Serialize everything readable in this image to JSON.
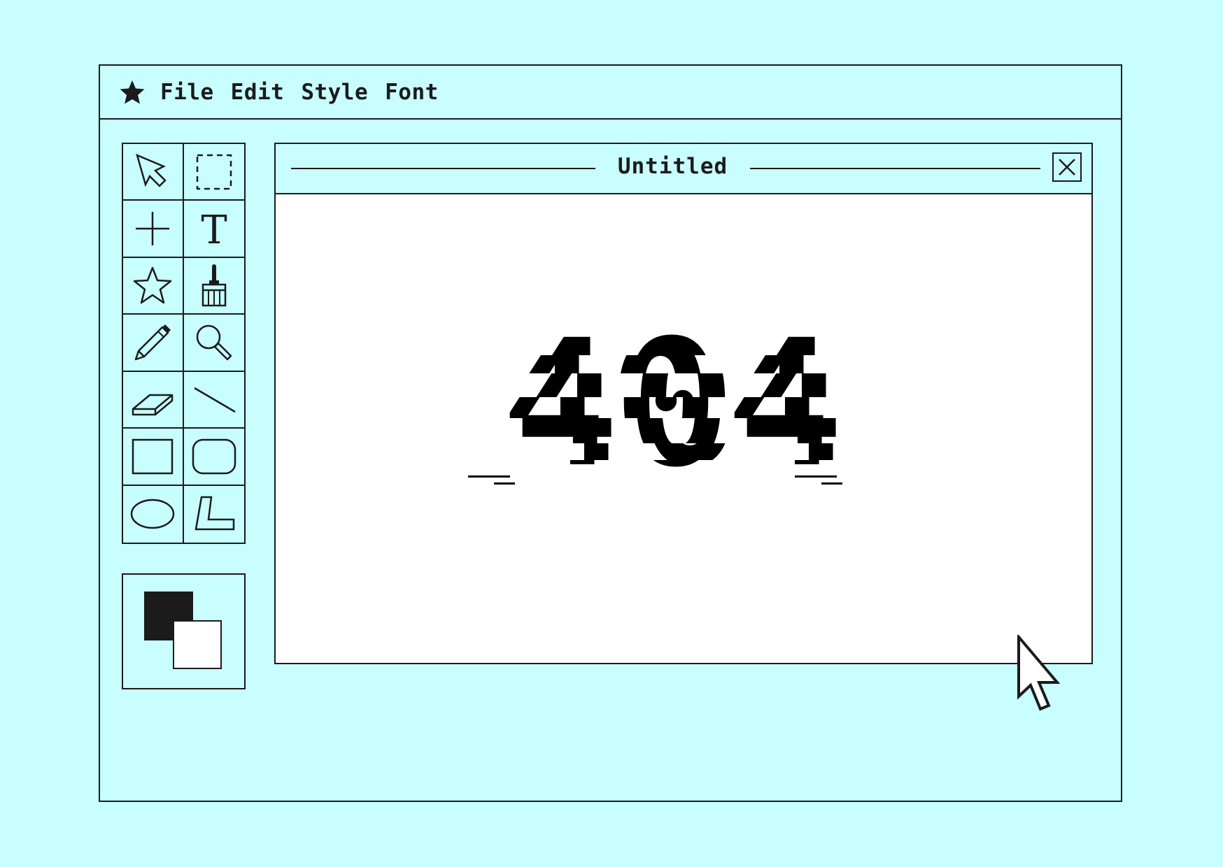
{
  "menubar": {
    "logo_icon": "star-icon",
    "items": [
      "File",
      "Edit",
      "Style",
      "Font"
    ]
  },
  "document": {
    "title": "Untitled",
    "canvas_text": "404"
  },
  "tools": [
    {
      "name": "arrow-select-icon"
    },
    {
      "name": "marquee-select-icon"
    },
    {
      "name": "crosshair-icon"
    },
    {
      "name": "text-tool-icon",
      "glyph": "T"
    },
    {
      "name": "star-shape-icon"
    },
    {
      "name": "paint-brush-icon"
    },
    {
      "name": "pencil-icon"
    },
    {
      "name": "magnifier-icon"
    },
    {
      "name": "eraser-icon"
    },
    {
      "name": "line-tool-icon"
    },
    {
      "name": "rectangle-tool-icon"
    },
    {
      "name": "rounded-rectangle-tool-icon"
    },
    {
      "name": "ellipse-tool-icon"
    },
    {
      "name": "polygon-tool-icon"
    }
  ],
  "colors": {
    "background": "#c8fefd",
    "ink": "#1b1b1b",
    "foreground_swatch": "#1b1b1b",
    "background_swatch": "#ffffff"
  }
}
